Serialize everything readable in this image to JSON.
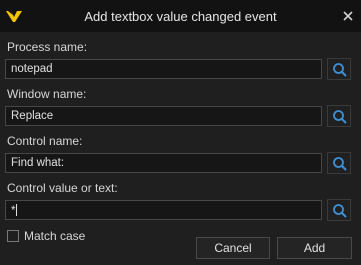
{
  "window": {
    "title": "Add textbox value changed event",
    "logo_icon": "app-logo-icon",
    "close_icon": "close-icon"
  },
  "fields": [
    {
      "label": "Process name:",
      "value": "notepad"
    },
    {
      "label": "Window name:",
      "value": "Replace"
    },
    {
      "label": "Control name:",
      "value": "Find what:"
    },
    {
      "label": "Control value or text:",
      "value": "*"
    }
  ],
  "search_icon": "magnifier-icon",
  "match_case": {
    "label": "Match case",
    "checked": false
  },
  "buttons": {
    "cancel": "Cancel",
    "add": "Add"
  },
  "colors": {
    "accent": "#3d8fd6",
    "logo": "#f5c400"
  }
}
